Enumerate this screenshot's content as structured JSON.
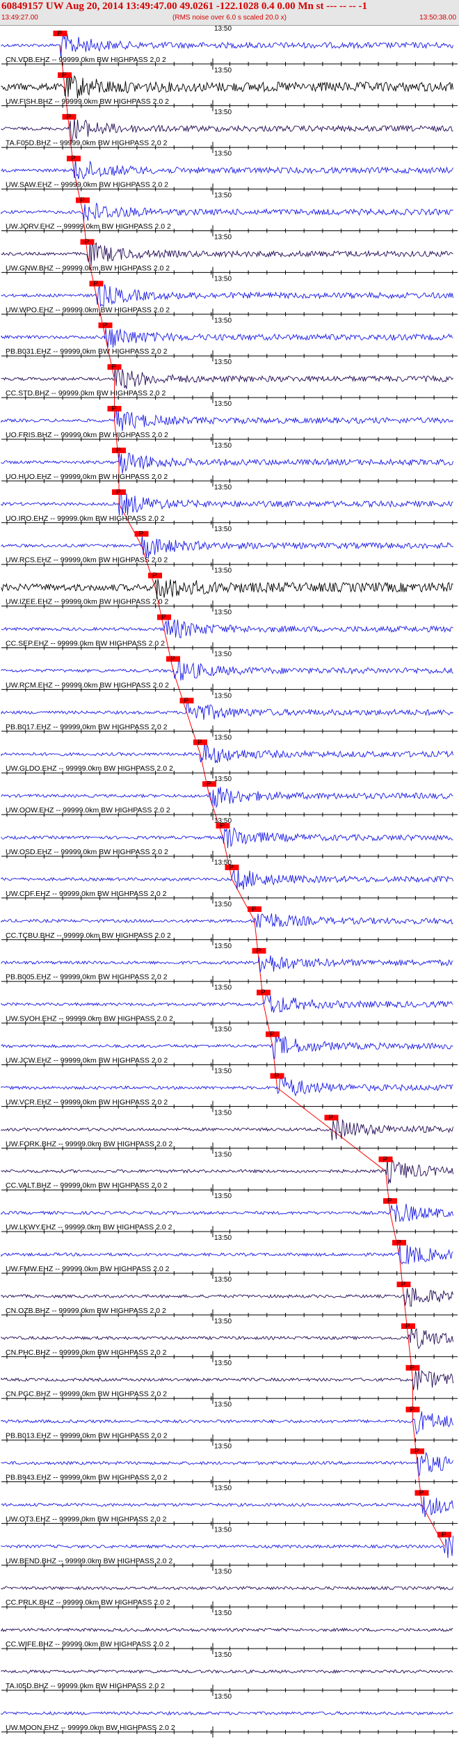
{
  "header": {
    "title": "60849157 UW Aug 20, 2014 13:49:47.00   49.0261 -122.1028  0.4 0.00 Mn st --- -- --  -1",
    "start_time": "13:49:27.00",
    "note": "(RMS noise over 6.0 s scaled 20.0 x)",
    "end_time": "13:50:38.00"
  },
  "colors": {
    "header_text": "#d40000",
    "header_bg": "#e6e6e6",
    "trace_blue": "#1a1ae6",
    "trace_dark": "#220a55",
    "trace_black": "#000000",
    "pick": "#ff0000",
    "axis": "#000000"
  },
  "chart_data": {
    "type": "line",
    "title": "60849157 UW Aug 20, 2014 13:49:47.00",
    "x_range": [
      "13:49:27.00",
      "13:50:38.00"
    ],
    "time_marker": "13:50",
    "pick_label": "P",
    "channels": [
      {
        "name": "CN.VDB.EHZ -- 99999.0km BW  HIGHPASS  2.0  2",
        "color": "blue",
        "pick": 0.13
      },
      {
        "name": "UW.FISH.BHZ -- 99999.0km BW  HIGHPASS  2.0  2",
        "color": "black",
        "pick": 0.14
      },
      {
        "name": "TA.F05D.BHZ -- 99999.0km BW  HIGHPASS  2.0  2",
        "color": "dark",
        "pick": 0.15
      },
      {
        "name": "UW.SAW.EHZ -- 99999.0km BW  HIGHPASS  2.0  2",
        "color": "blue",
        "pick": 0.16
      },
      {
        "name": "UW.JORV.EHZ -- 99999.0km BW  HIGHPASS  2.0  2",
        "color": "blue",
        "pick": 0.18
      },
      {
        "name": "UW.GNW.BHZ -- 99999.0km BW  HIGHPASS  2.0  2",
        "color": "dark",
        "pick": 0.19
      },
      {
        "name": "UW.WPO.EHZ -- 99999.0km BW  HIGHPASS  2.0  2",
        "color": "blue",
        "pick": 0.21
      },
      {
        "name": "PB.B031.EHZ -- 99999.0km BW  HIGHPASS  2.0  2",
        "color": "blue",
        "pick": 0.23
      },
      {
        "name": "CC.STD.BHZ -- 99999.0km BW  HIGHPASS  2.0  2",
        "color": "dark",
        "pick": 0.25
      },
      {
        "name": "UO.FRIS.BHZ -- 99999.0km BW  HIGHPASS  2.0  2",
        "color": "blue",
        "pick": 0.25
      },
      {
        "name": "UO.HUO.EHZ -- 99999.0km BW  HIGHPASS  2.0  2",
        "color": "blue",
        "pick": 0.26
      },
      {
        "name": "UO.IRO.EHZ -- 99999.0km BW  HIGHPASS  2.0  2",
        "color": "blue",
        "pick": 0.26
      },
      {
        "name": "UW.RCS.EHZ -- 99999.0km BW  HIGHPASS  2.0  2",
        "color": "blue",
        "pick": 0.31
      },
      {
        "name": "UW.IZEE.EHZ -- 99999.0km BW  HIGHPASS  2.0  2",
        "color": "black",
        "pick": 0.34
      },
      {
        "name": "CC.SEP.EHZ -- 99999.0km BW  HIGHPASS  2.0  2",
        "color": "blue",
        "pick": 0.36
      },
      {
        "name": "UW.RCM.EHZ -- 99999.0km BW  HIGHPASS  2.0  2",
        "color": "blue",
        "pick": 0.38
      },
      {
        "name": "PB.B017.EHZ -- 99999.0km BW  HIGHPASS  2.0  2",
        "color": "blue",
        "pick": 0.41
      },
      {
        "name": "UW.GLDO.EHZ -- 99999.0km BW  HIGHPASS  2.0  2",
        "color": "blue",
        "pick": 0.44
      },
      {
        "name": "UW.OOW.EHZ -- 99999.0km BW  HIGHPASS  2.0  2",
        "color": "blue",
        "pick": 0.46
      },
      {
        "name": "UW.OSD.EHZ -- 99999.0km BW  HIGHPASS  2.0  2",
        "color": "blue",
        "pick": 0.49
      },
      {
        "name": "UW.CDF.EHZ -- 99999.0km BW  HIGHPASS  2.0  2",
        "color": "blue",
        "pick": 0.51
      },
      {
        "name": "CC.TCBU.BHZ -- 99999.0km BW  HIGHPASS  2.0  2",
        "color": "blue",
        "pick": 0.56
      },
      {
        "name": "PB.B005.EHZ -- 99999.0km BW  HIGHPASS  2.0  2",
        "color": "blue",
        "pick": 0.57
      },
      {
        "name": "UW.SVOH.EHZ -- 99999.0km BW  HIGHPASS  2.0  2",
        "color": "blue",
        "pick": 0.58
      },
      {
        "name": "UW.JCW.EHZ -- 99999.0km BW  HIGHPASS  2.0  2",
        "color": "blue",
        "pick": 0.6
      },
      {
        "name": "UW.VCR.EHZ -- 99999.0km BW  HIGHPASS  2.0  2",
        "color": "blue",
        "pick": 0.61
      },
      {
        "name": "UW.FORK.BHZ -- 99999.0km BW  HIGHPASS  2.0  2",
        "color": "dark",
        "pick": 0.73
      },
      {
        "name": "CC.VALT.BHZ -- 99999.0km BW  HIGHPASS  2.0  2",
        "color": "dark",
        "pick": 0.85
      },
      {
        "name": "UW.LKWY.EHZ -- 99999.0km BW  HIGHPASS  2.0  2",
        "color": "blue",
        "pick": 0.86
      },
      {
        "name": "UW.FMW.EHZ -- 99999.0km BW  HIGHPASS  2.0  2",
        "color": "blue",
        "pick": 0.88
      },
      {
        "name": "CN.OZB.BHZ -- 99999.0km BW  HIGHPASS  2.0  2",
        "color": "dark",
        "pick": 0.89
      },
      {
        "name": "CN.PHC.BHZ -- 99999.0km BW  HIGHPASS  2.0  2",
        "color": "dark",
        "pick": 0.9
      },
      {
        "name": "CN.PGC.BHZ -- 99999.0km BW  HIGHPASS  2.0  2",
        "color": "dark",
        "pick": 0.91
      },
      {
        "name": "PB.B013.EHZ -- 99999.0km BW  HIGHPASS  2.0  2",
        "color": "blue",
        "pick": 0.91
      },
      {
        "name": "PB.B943.EHZ -- 99999.0km BW  HIGHPASS  2.0  2",
        "color": "blue",
        "pick": 0.92
      },
      {
        "name": "UW.OT3.EHZ -- 99999.0km BW  HIGHPASS  2.0  2",
        "color": "blue",
        "pick": 0.93
      },
      {
        "name": "UW.BEND.BHZ -- 99999.0km BW  HIGHPASS  2.0  2",
        "color": "blue",
        "pick": 0.98
      },
      {
        "name": "CC.PRLK.BHZ -- 99999.0km BW  HIGHPASS  2.0  2",
        "color": "dark",
        "pick": null
      },
      {
        "name": "CC.WIFE.BHZ -- 99999.0km BW  HIGHPASS  2.0  2",
        "color": "dark",
        "pick": null
      },
      {
        "name": "TA.I05D.BHZ -- 99999.0km BW  HIGHPASS  2.0  2",
        "color": "dark",
        "pick": null
      },
      {
        "name": "UW.MOON.EHZ -- 99999.0km BW  HIGHPASS  2.0  2",
        "color": "blue",
        "pick": null
      }
    ]
  }
}
